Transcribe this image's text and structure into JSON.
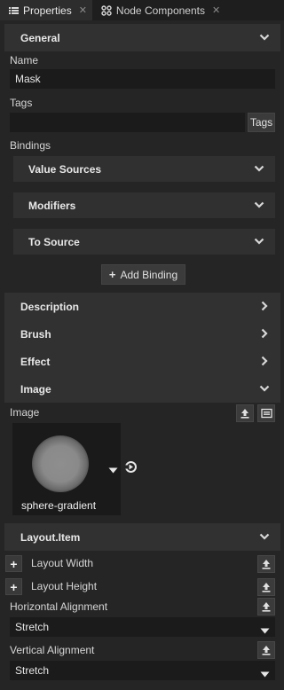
{
  "tabs": [
    {
      "label": "Properties",
      "icon": "list-icon",
      "active": true
    },
    {
      "label": "Node Components",
      "icon": "node-components-icon",
      "active": false
    }
  ],
  "general": {
    "title": "General",
    "name_label": "Name",
    "name_value": "Mask",
    "tags_label": "Tags",
    "tags_value": "",
    "tags_button": "Tags",
    "bindings_label": "Bindings",
    "value_sources": "Value Sources",
    "modifiers": "Modifiers",
    "to_source": "To Source",
    "add_binding": "Add Binding"
  },
  "sections": {
    "description": "Description",
    "brush": "Brush",
    "effect": "Effect",
    "image": "Image"
  },
  "image": {
    "label": "Image",
    "asset_name": "sphere-gradient"
  },
  "layout": {
    "title": "Layout.Item",
    "layout_width": "Layout Width",
    "layout_height": "Layout Height",
    "horizontal_alignment_label": "Horizontal Alignment",
    "horizontal_alignment_value": "Stretch",
    "vertical_alignment_label": "Vertical Alignment",
    "vertical_alignment_value": "Stretch"
  },
  "colors": {
    "background": "#252525",
    "header": "#313131",
    "field": "#1b1b1b"
  }
}
